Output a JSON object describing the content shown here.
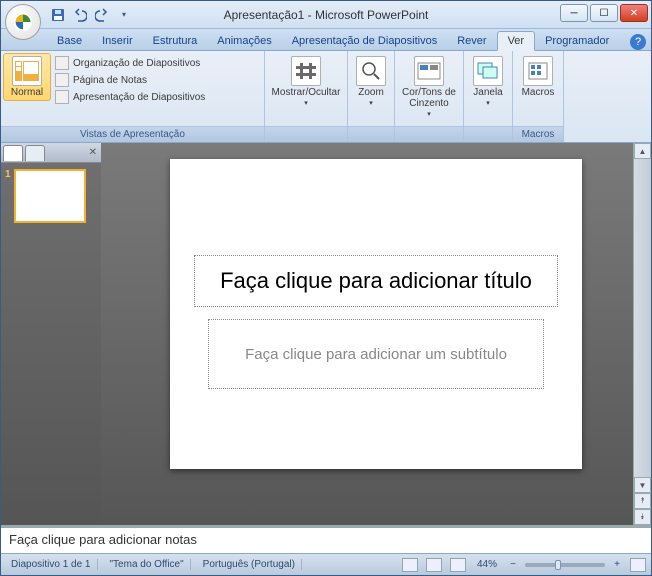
{
  "titlebar": {
    "title": "Apresentação1 - Microsoft PowerPoint"
  },
  "tabs": {
    "items": [
      "Base",
      "Inserir",
      "Estrutura",
      "Animações",
      "Apresentação de Diapositivos",
      "Rever",
      "Ver",
      "Programador"
    ],
    "active": 6
  },
  "ribbon": {
    "normal": "Normal",
    "org": "Organização de Diapositivos",
    "notas": "Página de Notas",
    "apres": "Apresentação de Diapositivos",
    "group_views": "Vistas de Apresentação",
    "mostrar": "Mostrar/Ocultar",
    "zoom": "Zoom",
    "cortons": "Cor/Tons de Cinzento",
    "janela": "Janela",
    "macros": "Macros",
    "group_macros": "Macros"
  },
  "thumbs": {
    "num1": "1"
  },
  "slide": {
    "title_placeholder": "Faça clique para adicionar título",
    "subtitle_placeholder": "Faça clique para adicionar um subtítulo"
  },
  "notes": {
    "placeholder": "Faça clique para adicionar notas"
  },
  "status": {
    "slide_pos": "Diapositivo 1 de 1",
    "theme": "\"Tema do Office\"",
    "lang": "Português (Portugal)",
    "zoom": "44%"
  }
}
